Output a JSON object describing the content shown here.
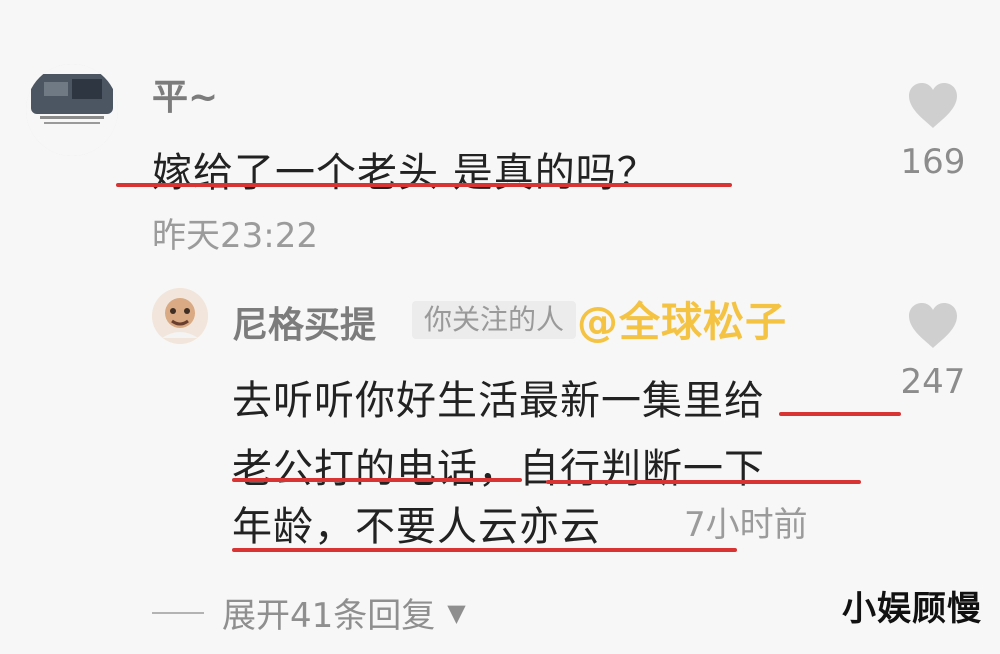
{
  "thread": {
    "main_comment": {
      "username": "平~",
      "text": "嫁给了一个老头 是真的吗？",
      "time": "昨天23:22",
      "likes": "169"
    },
    "reply": {
      "username": "尼格买提",
      "tag": "你关注的人",
      "watermark": "@全球松子",
      "lines": [
        "去听听你好生活最新一集里给",
        "老公打的电话，自行判断一下",
        "年龄，不要人云亦云"
      ],
      "time": "7小时前",
      "likes": "247"
    },
    "expand_label": "展开41条回复",
    "site_mark": "小娱顾慢"
  },
  "icons": {
    "like": "heart-icon",
    "expand": "chevron-down-icon"
  },
  "colors": {
    "underline": "#d93434",
    "watermark": "#f4c343"
  }
}
